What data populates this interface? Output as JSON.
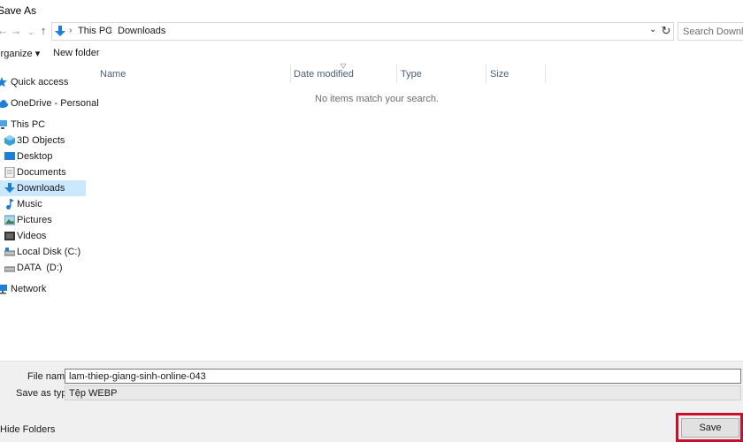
{
  "window": {
    "title": "Save As"
  },
  "nav": {
    "back_glyph": "←",
    "forward_glyph": "→",
    "recent_glyph": "⌄",
    "up_glyph": "↑",
    "breadcrumb": [
      "This PC",
      "Downloads"
    ],
    "breadcrumb_sep": "›",
    "dropdown_glyph": "⌄",
    "refresh_glyph": "↻",
    "search_placeholder": "Search Downloads"
  },
  "toolbar": {
    "organize": "Organize ▾",
    "new_folder": "New folder"
  },
  "sidebar": {
    "items": [
      {
        "label": "Quick access",
        "icon": "star-icon"
      },
      {
        "label": "OneDrive - Personal",
        "icon": "cloud-icon"
      },
      {
        "label": "This PC",
        "icon": "computer-icon"
      },
      {
        "label": "3D Objects",
        "icon": "cube-icon"
      },
      {
        "label": "Desktop",
        "icon": "desktop-icon"
      },
      {
        "label": "Documents",
        "icon": "document-icon"
      },
      {
        "label": "Downloads",
        "icon": "download-icon",
        "selected": true
      },
      {
        "label": "Music",
        "icon": "music-icon"
      },
      {
        "label": "Pictures",
        "icon": "pictures-icon"
      },
      {
        "label": "Videos",
        "icon": "videos-icon"
      },
      {
        "label": "Local Disk (C:)",
        "icon": "drive-icon"
      },
      {
        "label": "DATA  (D:)",
        "icon": "drive-icon"
      },
      {
        "label": "Network",
        "icon": "network-icon"
      }
    ]
  },
  "filelist": {
    "columns": [
      "Name",
      "Date modified",
      "Type",
      "Size"
    ],
    "empty_message": "No items match your search."
  },
  "form": {
    "filename_label": "File name:",
    "filename_value": "lam-thiep-giang-sinh-online-043",
    "savetype_label": "Save as type:",
    "savetype_value": "Tệp WEBP",
    "hide_folders": "Hide Folders",
    "save_button": "Save"
  },
  "colors": {
    "selected_bg": "#cce8ff",
    "highlight_border": "#c8102e",
    "folder_blue": "#1f7fd6"
  }
}
